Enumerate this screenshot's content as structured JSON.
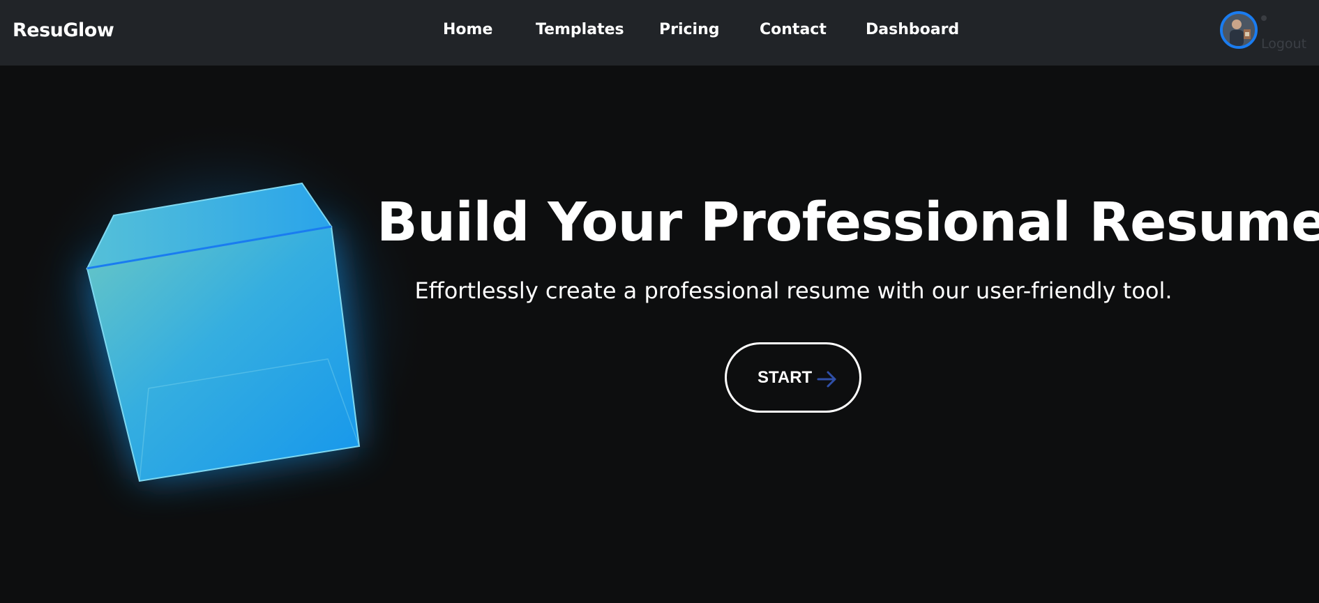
{
  "header": {
    "brand": "ResuGlow",
    "nav": [
      {
        "label": "Home"
      },
      {
        "label": "Templates"
      },
      {
        "label": "Pricing"
      },
      {
        "label": "Contact"
      },
      {
        "label": "Dashboard"
      }
    ],
    "logout_label": "Logout"
  },
  "hero": {
    "title": "Build Your Professional Resume",
    "subtitle": "Effortlessly create a professional resume with our user-friendly tool.",
    "cta_label": "START",
    "cta_icon": "arrow-right-icon"
  },
  "colors": {
    "navbar_bg": "#212428",
    "page_bg": "#0d0e0f",
    "accent_blue": "#1a7cf0",
    "cube_glow": "#1aa3ff",
    "arrow": "#2f4fa8"
  }
}
